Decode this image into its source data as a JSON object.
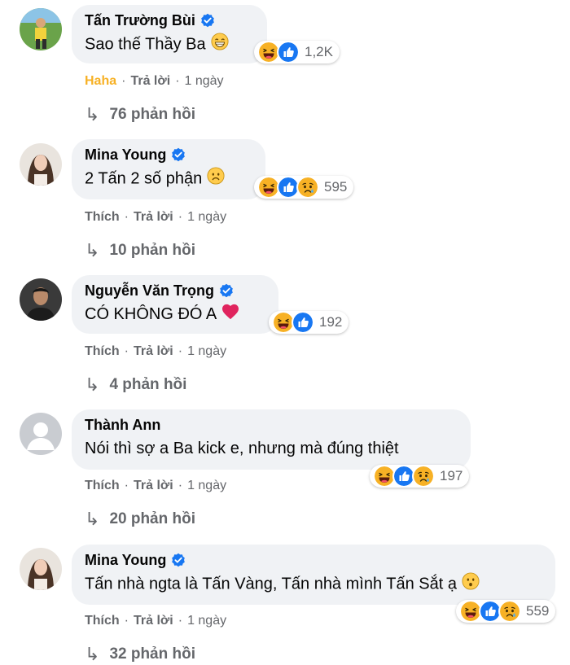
{
  "comments": [
    {
      "name": "Tấn Trường Bùi",
      "text": "Sao thế Thầy Ba",
      "inline_emoji": "grinning",
      "reactions": [
        "haha",
        "like"
      ],
      "reaction_count": "1,2K",
      "action_label": "Haha",
      "reply_label": "Trả lời",
      "time": "1 ngày",
      "replies": "76 phản hồi"
    },
    {
      "name": "Mina Young",
      "text": "2 Tấn 2 số phận",
      "inline_emoji": "frown",
      "reactions": [
        "haha",
        "like",
        "sad"
      ],
      "reaction_count": "595",
      "action_label": "Thích",
      "reply_label": "Trả lời",
      "time": "1 ngày",
      "replies": "10 phản hồi"
    },
    {
      "name": "Nguyễn Văn Trọng",
      "text": "CÓ KHÔNG ĐÓ A",
      "inline_emoji": "red-heart",
      "reactions": [
        "haha",
        "like"
      ],
      "reaction_count": "192",
      "action_label": "Thích",
      "reply_label": "Trả lời",
      "time": "1 ngày",
      "replies": "4 phản hồi"
    },
    {
      "name": "Thành Ann",
      "text": "Nói thì sợ a Ba kick e, nhưng mà đúng thiệt",
      "inline_emoji": "",
      "reactions": [
        "haha",
        "like",
        "sad"
      ],
      "reaction_count": "197",
      "action_label": "Thích",
      "reply_label": "Trả lời",
      "time": "1 ngày",
      "replies": "20 phản hồi"
    },
    {
      "name": "Mina Young",
      "text": "Tấn nhà ngta là Tấn Vàng, Tấn nhà mình Tấn Sắt ạ",
      "inline_emoji": "hushed",
      "reactions": [
        "haha",
        "like",
        "sad"
      ],
      "reaction_count": "559",
      "action_label": "Thích",
      "reply_label": "Trả lời",
      "time": "1 ngày",
      "replies": "32 phản hồi"
    }
  ],
  "colors": {
    "bubble": "#f0f2f5",
    "meta": "#65676b",
    "haha_label": "#f7b125",
    "verified": "#1877f2",
    "like": "#1877f2",
    "haha": "#f7b125",
    "heart": "#f33e58"
  },
  "icons": {
    "verified": "verified-badge-icon",
    "reply_arrow": "reply-arrow-icon",
    "like": "like-reaction-icon",
    "haha": "haha-reaction-icon",
    "sad": "sad-reaction-icon"
  }
}
